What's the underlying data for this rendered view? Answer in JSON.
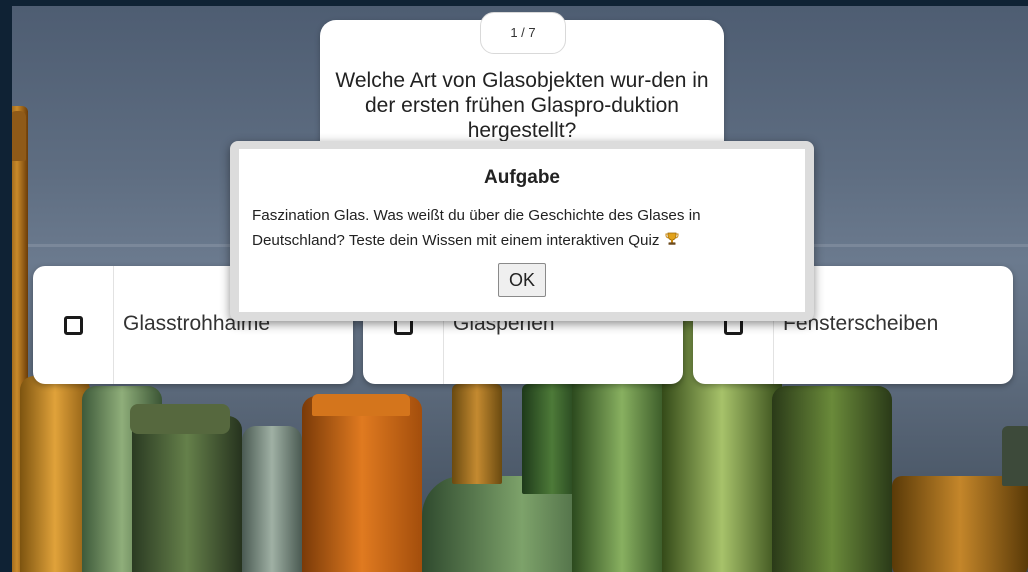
{
  "quiz": {
    "counter": "1 / 7",
    "question": "Welche Art von Glasobjekten wur-den in der ersten frühen Glaspro-duktion hergestellt?",
    "answers": [
      {
        "label": "Glasstrohhalme",
        "checked": false
      },
      {
        "label": "Glasperlen",
        "checked": false
      },
      {
        "label": "Fensterscheiben",
        "checked": false
      }
    ]
  },
  "dialog": {
    "title": "Aufgabe",
    "message": "Faszination Glas. Was weißt du über die Geschichte des Glases in Deutschland? Teste dein Wissen mit einem interaktiven Quiz",
    "icon": "trophy-icon",
    "ok_label": "OK"
  },
  "colors": {
    "page_border": "#0f2234",
    "card": "#ffffff",
    "dialog_frame": "#dcdcdc"
  }
}
